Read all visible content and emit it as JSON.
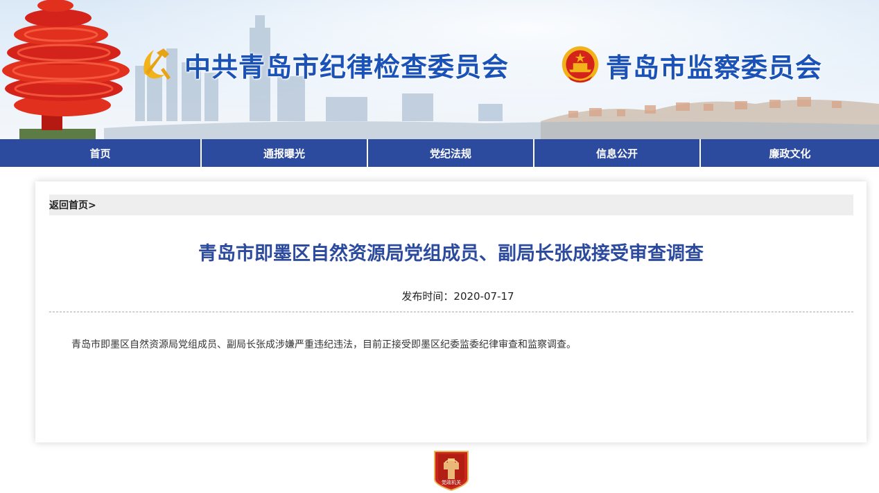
{
  "header": {
    "org_title_1": "中共青岛市纪律检查委员会",
    "org_title_2": "青岛市监察委员会"
  },
  "nav": {
    "items": [
      {
        "label": "首页"
      },
      {
        "label": "通报曝光"
      },
      {
        "label": "党纪法规"
      },
      {
        "label": "信息公开"
      },
      {
        "label": "廉政文化"
      }
    ]
  },
  "breadcrumb": {
    "label": "返回首页>"
  },
  "article": {
    "title": "青岛市即墨区自然资源局党组成员、副局长张成接受审查调查",
    "publish_label": "发布时间：",
    "publish_date": "2020-07-17",
    "body": "青岛市即墨区自然资源局党组成员、副局长张成涉嫌严重违纪违法，目前正接受即墨区纪委监委纪律审查和监察调查。"
  },
  "footer": {
    "logo_text": "党政机关"
  },
  "colors": {
    "nav_bg": "#2c4a9e",
    "title_blue": "#1a52b8",
    "article_title": "#2c4a9e",
    "party_red": "#d4231a",
    "gold": "#f2b21a"
  },
  "icons": {
    "party_emblem": "hammer-sickle-icon",
    "national_emblem": "national-emblem-icon",
    "footer": "party-government-org-icon"
  }
}
